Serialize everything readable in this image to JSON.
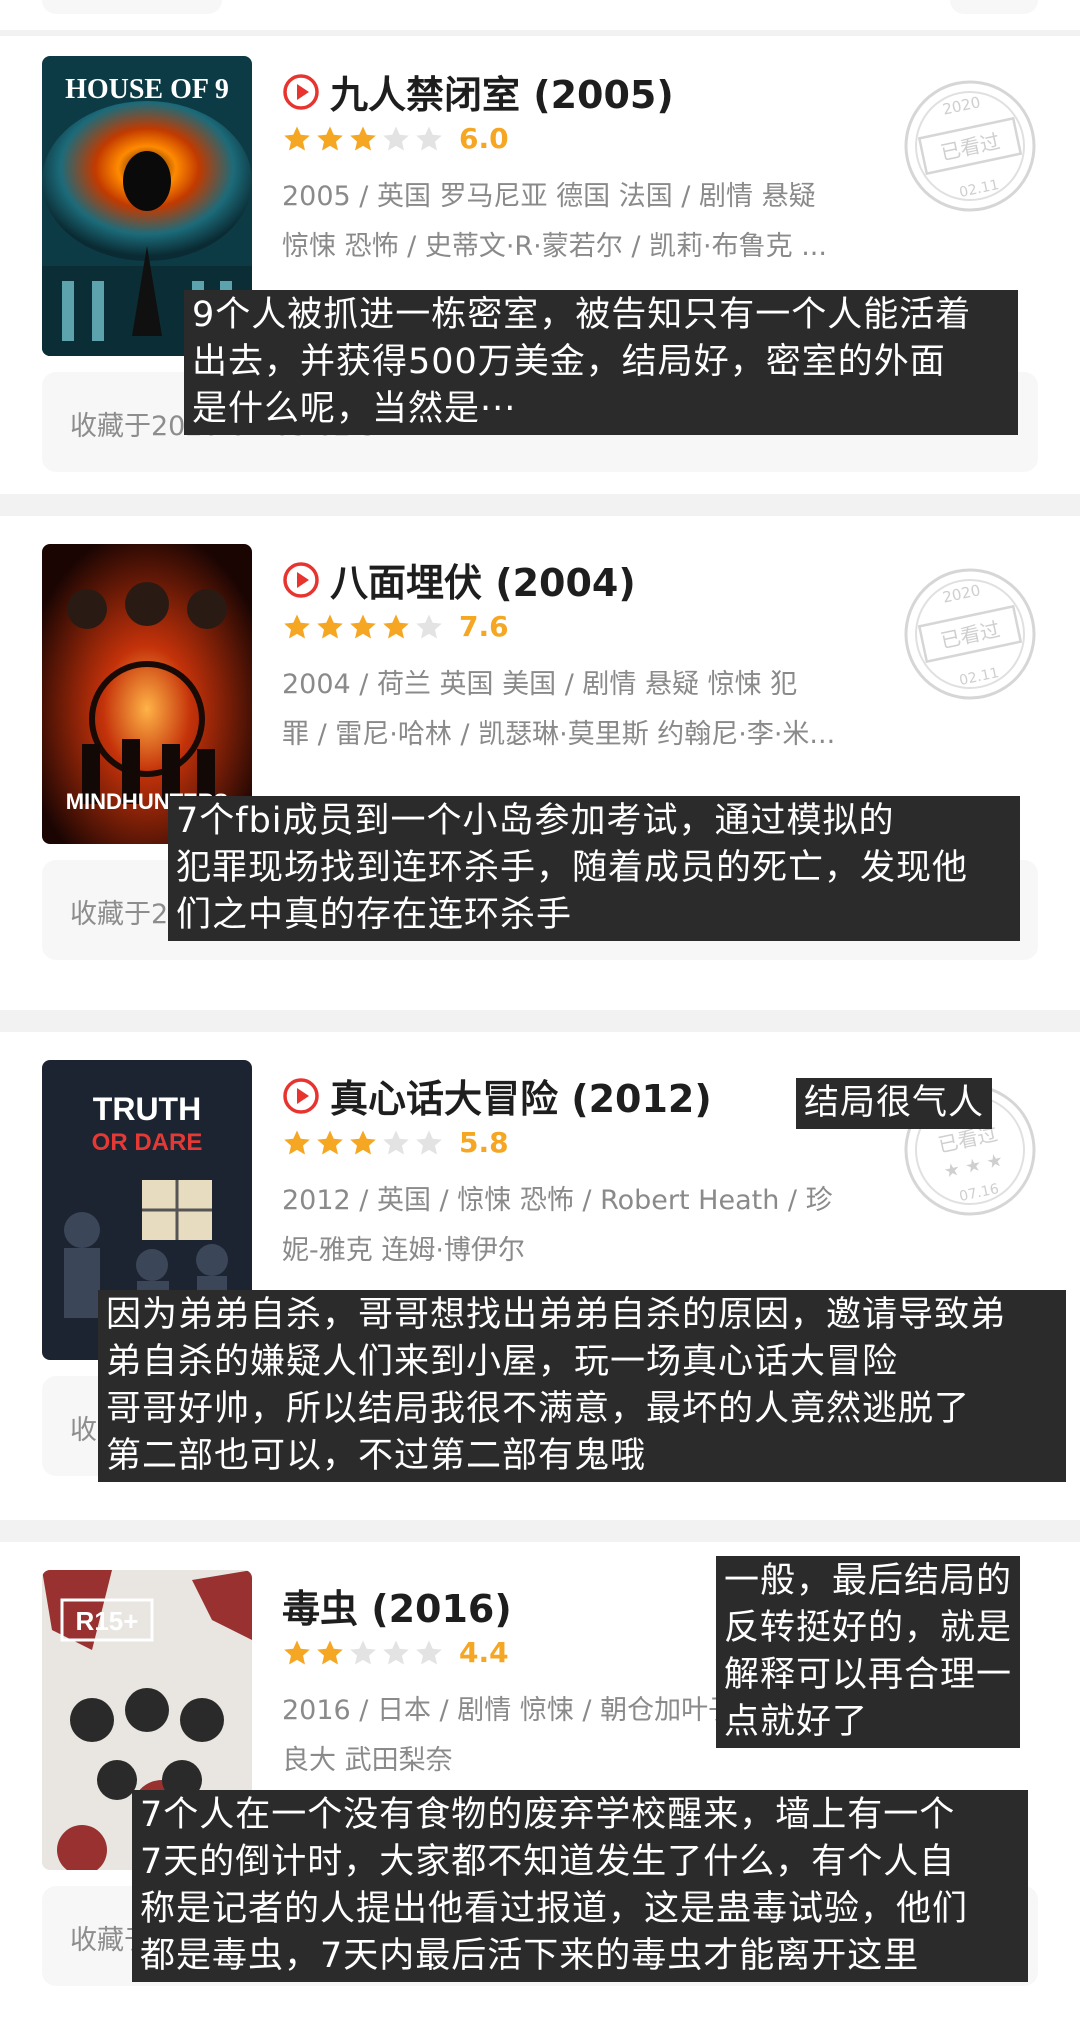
{
  "colors": {
    "accent": "#e8342f",
    "star": "#f5a623",
    "overlay_bg": "#2b2b2b"
  },
  "movies": [
    {
      "title": "九人禁闭室 (2005)",
      "rating_stars": 3,
      "score": "6.0",
      "meta_line1": "2005 / 英国 罗马尼亚 德国 法国 / 剧情 悬疑",
      "meta_line2": "惊悚 恐怖 / 史蒂文·R·蒙若尔 / 凯莉·布鲁克 ...",
      "stamp_year": "2020",
      "stamp_label": "已看过",
      "stamp_date": "02.11",
      "poster_text": "HOUSE OF 9",
      "collect_text": "收藏于2020-01-09 02:31",
      "overlay": "9个人被抓进一栋密室，被告知只有一个人能活着\n出去，并获得500万美金，结局好，密室的外面\n是什么呢，当然是···"
    },
    {
      "title": "八面埋伏 (2004)",
      "rating_stars": 4,
      "score": "7.6",
      "meta_line1": "2004 / 荷兰 英国 美国 / 剧情 悬疑 惊悚 犯",
      "meta_line2": "罪 / 雷尼·哈林 / 凯瑟琳·莫里斯 约翰尼·李·米...",
      "stamp_year": "2020",
      "stamp_label": "已看过",
      "stamp_date": "02.11",
      "poster_text": "MINDHUNTERS",
      "collect_text": "收藏于2",
      "overlay": "7个fbi成员到一个小岛参加考试，通过模拟的\n犯罪现场找到连环杀手，随着成员的死亡，发现他\n们之中真的存在连环杀手"
    },
    {
      "title": "真心话大冒险 (2012)",
      "rating_stars": 3,
      "score": "5.8",
      "meta_line1": "2012 / 英国 / 惊悚 恐怖 / Robert Heath / 珍",
      "meta_line2": "妮-雅克 连姆·博伊尔",
      "stamp_year": "",
      "stamp_label": "已看过",
      "stamp_date": "07.16",
      "poster_text_a": "TRUTH",
      "poster_text_b": "OR DARE",
      "collect_text": "收",
      "overlay": "因为弟弟自杀，哥哥想找出弟弟自杀的原因，邀请导致弟\n弟自杀的嫌疑人们来到小屋，玩一场真心话大冒险\n哥哥好帅，所以结局我很不满意，最坏的人竟然逃脱了\n第二部也可以，不过第二部有鬼哦",
      "side_note": "结局很气人"
    },
    {
      "title": "毒虫 (2016)",
      "rating_stars": 2,
      "score": "4.4",
      "meta_line1": "2016 / 日本 / 剧情 惊悚 / 朝仓加叶子",
      "meta_line2": "良大 武田梨奈",
      "poster_text": "R15+",
      "collect_text": "收藏于",
      "overlay": "7个人在一个没有食物的废弃学校醒来，墙上有一个\n7天的倒计时，大家都不知道发生了什么，有个人自\n称是记者的人提出他看过报道，这是蛊毒试验，他们\n都是毒虫，7天内最后活下来的毒虫才能离开这里",
      "side_note": "一般，最后结局的\n反转挺好的，就是\n解释可以再合理一\n点就好了"
    }
  ]
}
